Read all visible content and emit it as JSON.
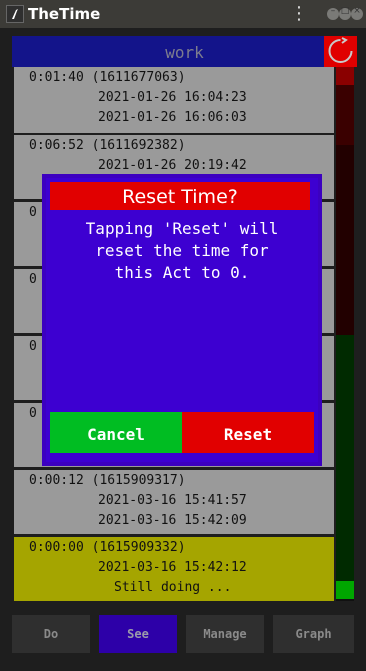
{
  "window": {
    "title": "TheTime"
  },
  "header": {
    "title": "work"
  },
  "entries": [
    {
      "duration_id": "0:01:40 (1611677063)",
      "start": "2021-01-26 16:04:23",
      "end": "2021-01-26 16:06:03"
    },
    {
      "duration_id": "0:06:52 (1611692382)",
      "start": "2021-01-26 20:19:42",
      "end": ""
    },
    {
      "duration_id": "0",
      "start": "",
      "end": ""
    },
    {
      "duration_id": "0",
      "start": "",
      "end": ""
    },
    {
      "duration_id": "0",
      "start": "",
      "end": ""
    },
    {
      "duration_id": "0",
      "start": "",
      "end": ""
    },
    {
      "duration_id": "0:00:12 (1615909317)",
      "start": "2021-03-16 15:41:57",
      "end": "2021-03-16 15:42:09"
    },
    {
      "duration_id": "0:00:00 (1615909332)",
      "start": "2021-03-16 15:42:12",
      "end": "Still doing ..."
    }
  ],
  "nav": {
    "do": "Do",
    "see": "See",
    "manage": "Manage",
    "graph": "Graph",
    "active": "See"
  },
  "dialog": {
    "title": "Reset Time?",
    "message": "Tapping 'Reset' will\nreset the time for\nthis Act to 0.",
    "cancel": "Cancel",
    "reset": "Reset"
  },
  "colors": {
    "header_bg": "#13148a",
    "dialog_bg": "#3d00d1",
    "title_red": "#e10000",
    "cancel_green": "#00bd22",
    "current_row": "#a5a500"
  }
}
